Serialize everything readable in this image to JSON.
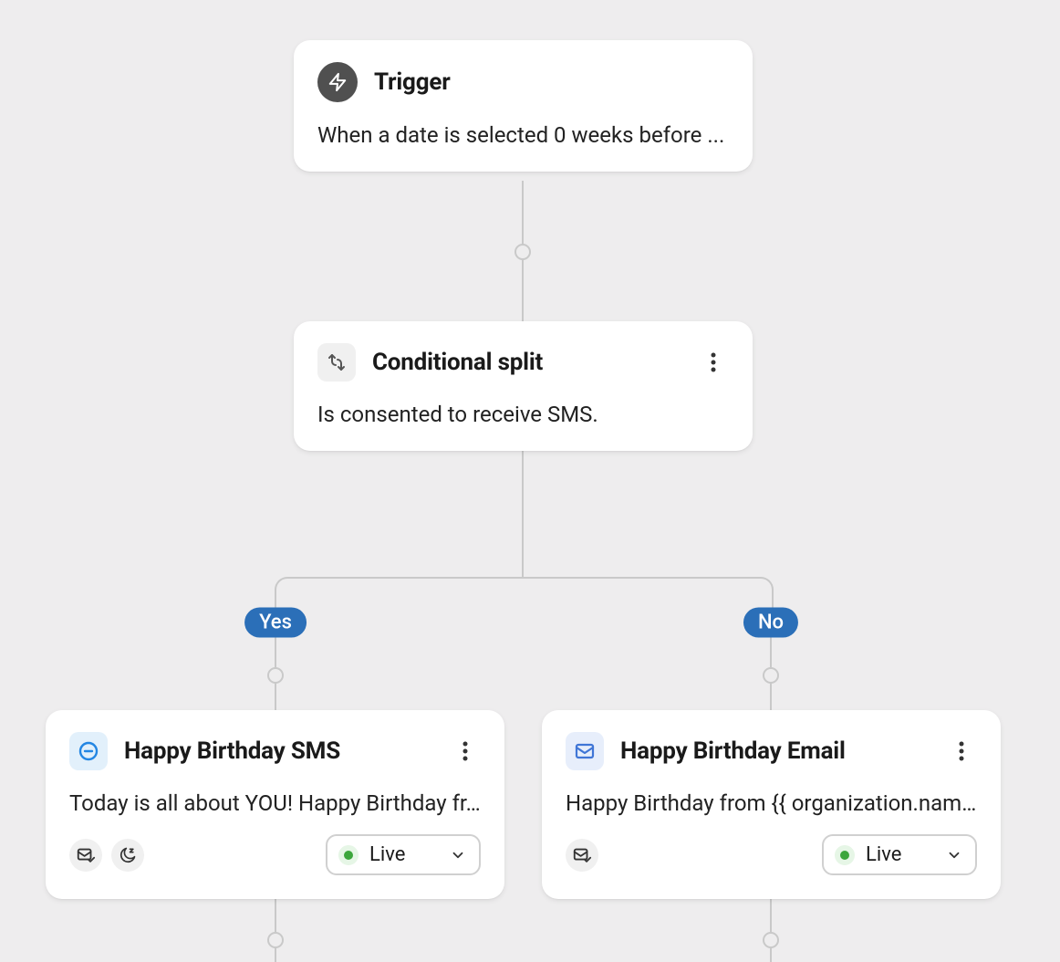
{
  "trigger": {
    "title": "Trigger",
    "description": "When a date is selected 0 weeks before ..."
  },
  "split": {
    "title": "Conditional split",
    "description": "Is consented to receive SMS."
  },
  "branches": {
    "left": {
      "label": "Yes",
      "card": {
        "title": "Happy Birthday SMS",
        "description": "Today is all about YOU! Happy Birthday fr...",
        "status": "Live",
        "icons": [
          "mail-check",
          "moon-sleep"
        ]
      }
    },
    "right": {
      "label": "No",
      "card": {
        "title": "Happy Birthday Email",
        "description": "Happy Birthday from {{ organization.nam...",
        "status": "Live",
        "icons": [
          "mail-check"
        ]
      }
    }
  },
  "colors": {
    "badge": "#2b6fb8",
    "live": "#3ca63c"
  }
}
